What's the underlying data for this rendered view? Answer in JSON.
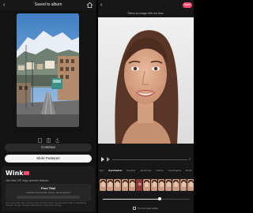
{
  "left": {
    "back_glyph": "‹",
    "title": "Saved to album",
    "continue_label": "Continue",
    "more_label": "More Features",
    "promo": {
      "logo": "Wink",
      "desc": "Join Wink VIP, enjoy premium features",
      "free_trial": "Free Trial",
      "trial_sub": "Unlimited access after 3 days, cancel anytime",
      "fine_print": "Auto-renew after trial. Cancel at least 24 hours before the trial period ends to avoid being charged. You can manage subscriptions in App Store settings."
    }
  },
  "right": {
    "back_glyph": "‹",
    "save_label": "Save",
    "hint": "Select an image with one face",
    "count": "2",
    "tabs": [
      "Eye",
      "Eyeshadow",
      "Eyeliner",
      "Eyebrows",
      "Lashes",
      "Eyeshadow",
      "Blush"
    ],
    "active_tab": 1,
    "thumb_count": 13,
    "selected_thumb": 5,
    "slider_value": 0.65,
    "bottom_label": "Try it on your photo"
  },
  "colors": {
    "accent": "#ff4b73",
    "panel_dark": "#131313"
  }
}
